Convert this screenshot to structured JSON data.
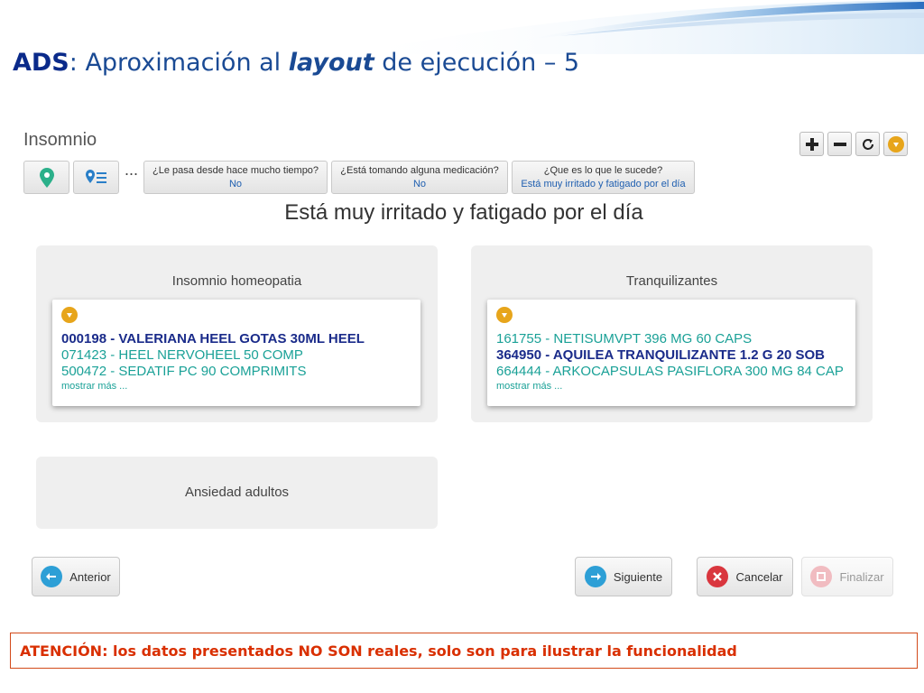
{
  "slide": {
    "title_prefix": "ADS",
    "title_mid": ": Aproximación al ",
    "title_em": "layout",
    "title_suffix": " de ejecución – 5",
    "warning": "ATENCIÓN: los datos presentados NO SON reales, solo son para ilustrar la funcionalidad"
  },
  "app": {
    "title": "Insomnio",
    "toolbar": {
      "icons": [
        "plus-icon",
        "minus-icon",
        "refresh-icon",
        "pill-badge-icon"
      ]
    },
    "nav": {
      "ellipsis": "...",
      "crumbs": [
        {
          "question": "¿Le pasa desde hace mucho tiempo?",
          "answer": "No"
        },
        {
          "question": "¿Está tomando alguna medicación?",
          "answer": "No"
        },
        {
          "question": "¿Que es lo que le sucede?",
          "answer": "Está muy irritado y fatigado por el día"
        }
      ]
    },
    "heading": "Está muy irritado y fatigado por el día",
    "cards": [
      {
        "title": "Insomnio homeopatia",
        "items": [
          {
            "text": "000198 - VALERIANA HEEL GOTAS 30ML HEEL",
            "selected": true
          },
          {
            "text": "071423 - HEEL NERVOHEEL 50 COMP",
            "selected": false
          },
          {
            "text": "500472 - SEDATIF PC 90 COMPRIMITS",
            "selected": false
          }
        ],
        "more": "mostrar más ..."
      },
      {
        "title": "Tranquilizantes",
        "items": [
          {
            "text": "161755 - NETISUMVPT 396 MG 60 CAPS",
            "selected": false
          },
          {
            "text": "364950 - AQUILEA TRANQUILIZANTE 1.2 G 20 SOB",
            "selected": true
          },
          {
            "text": "664444 - ARKOCAPSULAS PASIFLORA 300 MG 84 CAP",
            "selected": false
          }
        ],
        "more": "mostrar más ..."
      },
      {
        "title": "Ansiedad adultos"
      }
    ],
    "buttons": {
      "previous": "Anterior",
      "next": "Siguiente",
      "cancel": "Cancelar",
      "finish": "Finalizar"
    }
  },
  "colors": {
    "title": "#1a4a94",
    "accent_teal": "#1aa197",
    "selected_med": "#1a2b8a",
    "badge": "#e7a51b",
    "cancel_red": "#d9363e",
    "warning": "#d92f00"
  }
}
